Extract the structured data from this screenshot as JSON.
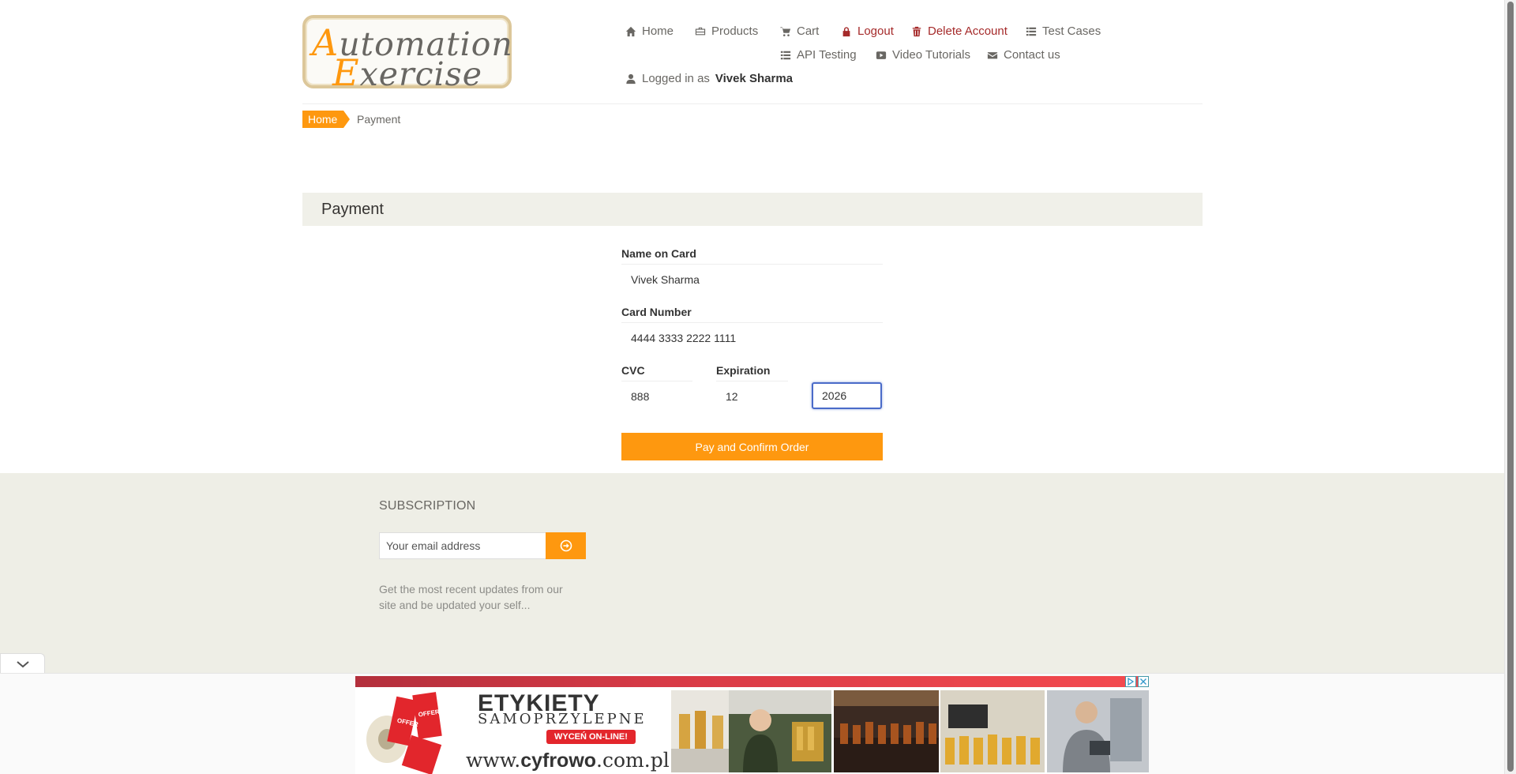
{
  "logo": {
    "line1_cap": "A",
    "line1_rest": "utomation",
    "line2_cap": "E",
    "line2_rest": "xercise"
  },
  "nav": {
    "home": "Home",
    "products": "Products",
    "cart": "Cart",
    "logout": "Logout",
    "delete_account": "Delete Account",
    "test_cases": "Test Cases",
    "api_testing": "API Testing",
    "video_tutorials": "Video Tutorials",
    "contact_us": "Contact us",
    "logged_in_prefix": "Logged in as",
    "logged_in_user": "Vivek Sharma"
  },
  "breadcrumb": {
    "home": "Home",
    "current": "Payment"
  },
  "payment": {
    "heading": "Payment",
    "name_label": "Name on Card",
    "name_value": "Vivek Sharma",
    "card_label": "Card Number",
    "card_value": "4444 3333 2222 1111",
    "cvc_label": "CVC",
    "cvc_value": "888",
    "expiration_label": "Expiration",
    "exp_month_value": "12",
    "exp_year_value": "2026",
    "submit_label": "Pay and Confirm Order"
  },
  "footer": {
    "subscription_title": "SUBSCRIPTION",
    "email_placeholder": "Your email address",
    "subscription_desc": "Get the most recent updates from our site and be updated your self..."
  },
  "ad": {
    "headline": "ETYKIETY",
    "subline": "SAMOPRZYLEPNE",
    "pill": "WYCEŃ ON-LINE!",
    "url_prefix": "www.",
    "url_brand": "cyfrowo",
    "url_suffix": ".com.pl",
    "roll_label": "OFFER"
  },
  "colors": {
    "accent": "#fe980f",
    "danger": "#a52a2a",
    "panel": "#f0f0e9",
    "footer": "#eeeee6",
    "focus": "#4a6bc9"
  },
  "icons": [
    "home-icon",
    "briefcase-icon",
    "cart-icon",
    "lock-icon",
    "trash-icon",
    "list-icon",
    "video-icon",
    "envelope-icon",
    "user-icon",
    "arrow-circle-right-icon",
    "chevron-down-icon"
  ]
}
